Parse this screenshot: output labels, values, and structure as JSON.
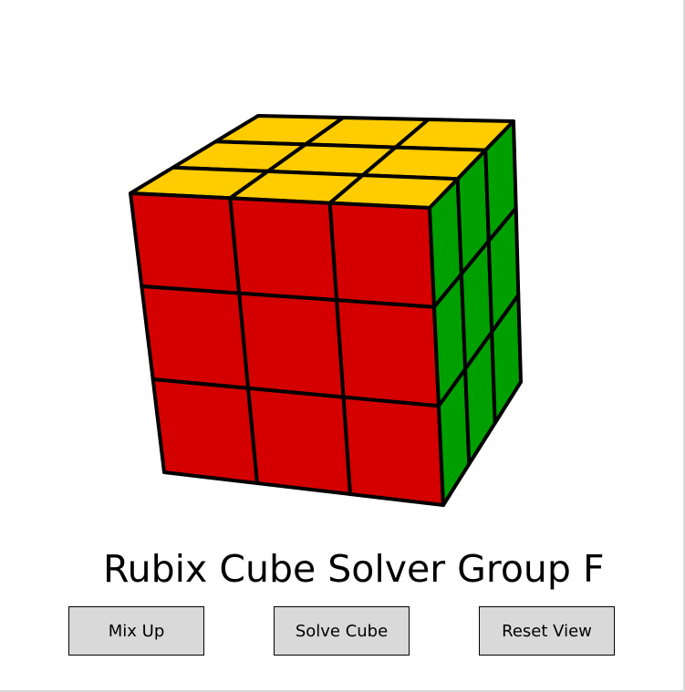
{
  "title": "Rubix Cube Solver Group F",
  "buttons": {
    "mix_up": "Mix Up",
    "solve_cube": "Solve Cube",
    "reset_view": "Reset View"
  },
  "cube": {
    "colors": {
      "yellow": "#ffcc00",
      "red": "#d40000",
      "green": "#009f00",
      "edge": "#000000"
    },
    "faces": {
      "top": [
        "yellow",
        "yellow",
        "yellow",
        "yellow",
        "yellow",
        "yellow",
        "yellow",
        "yellow",
        "yellow"
      ],
      "front": [
        "red",
        "red",
        "red",
        "red",
        "red",
        "red",
        "red",
        "red",
        "red"
      ],
      "right": [
        "green",
        "green",
        "green",
        "green",
        "green",
        "green",
        "green",
        "green",
        "green"
      ]
    }
  },
  "theme": {
    "button_bg": "#d9d9d9",
    "background": "#ffffff"
  }
}
